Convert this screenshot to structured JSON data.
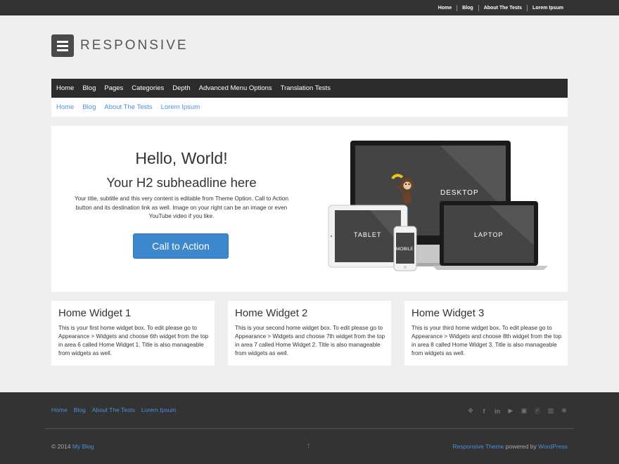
{
  "top_menu": [
    "Home",
    "Blog",
    "About The Tests",
    "Lorem Ipsum"
  ],
  "logo": {
    "text": "RESPONSIVE",
    "icon": "menu-icon"
  },
  "main_nav": [
    "Home",
    "Blog",
    "Pages",
    "Categories",
    "Depth",
    "Advanced Menu Options",
    "Translation Tests"
  ],
  "sub_nav": [
    "Home",
    "Blog",
    "About The Tests",
    "Lorem Ipsum"
  ],
  "hero": {
    "title": "Hello, World!",
    "subtitle": "Your H2 subheadline here",
    "text": "Your title, subtitle and this very content is editable from Theme Option. Call to Action button and its destination link as well. Image on your right can be an image or even YouTube video if you like.",
    "cta": "Call to Action",
    "devices": {
      "desktop": "DESKTOP",
      "tablet": "TABLET",
      "mobile": "MOBILE",
      "laptop": "LAPTOP"
    }
  },
  "widgets": [
    {
      "title": "Home Widget 1",
      "text": "This is your first home widget box. To edit please go to Appearance > Widgets and choose 6th widget from the top in area 6 called Home Widget 1. Title is also manageable from widgets as well."
    },
    {
      "title": "Home Widget 2",
      "text": "This is your second home widget box. To edit please go to Appearance > Widgets and choose 7th widget from the top in area 7 called Home Widget 2. Title is also manageable from widgets as well."
    },
    {
      "title": "Home Widget 3",
      "text": "This is your third home widget box. To edit please go to Appearance > Widgets and choose 8th widget from the top in area 8 called Home Widget 3. Title is also manageable from widgets as well."
    }
  ],
  "footer": {
    "links": [
      "Home",
      "Blog",
      "About The Tests",
      "Lorem Ipsum"
    ],
    "social_icons": [
      "twitter-icon",
      "facebook-icon",
      "linkedin-icon",
      "youtube-icon",
      "instagram-icon",
      "pinterest-icon",
      "vimeo-icon",
      "yelp-icon"
    ],
    "copyright_prefix": "© 2014",
    "copyright_site": "My Blog",
    "scroll_top": "↑",
    "theme_link": "Responsive Theme",
    "powered_text": "powered by",
    "wp_link": "WordPress"
  },
  "colors": {
    "accent": "#3d88cd",
    "link": "#4a90d9",
    "dark": "#333333",
    "background": "#efefef"
  }
}
